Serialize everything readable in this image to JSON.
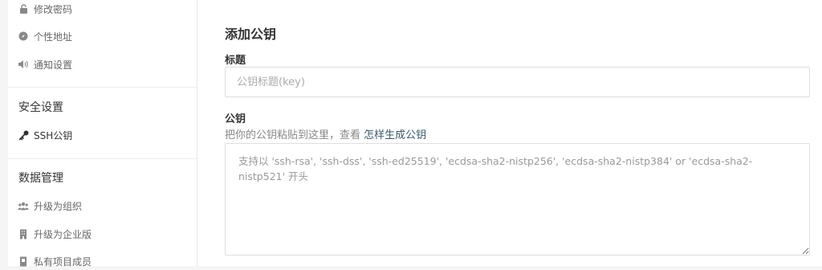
{
  "sidebar": {
    "items_top": [
      {
        "label": "修改密码",
        "icon": "lock-icon"
      },
      {
        "label": "个性地址",
        "icon": "compass-icon"
      },
      {
        "label": "通知设置",
        "icon": "volume-icon"
      }
    ],
    "security": {
      "title": "安全设置",
      "items": [
        {
          "label": "SSH公钥",
          "icon": "key-icon"
        }
      ]
    },
    "data_management": {
      "title": "数据管理",
      "items": [
        {
          "label": "升级为组织",
          "icon": "users-icon"
        },
        {
          "label": "升级为企业版",
          "icon": "building-icon"
        },
        {
          "label": "私有项目成员",
          "icon": "member-icon"
        }
      ]
    }
  },
  "form": {
    "heading": "添加公钥",
    "title_label": "标题",
    "title_placeholder": "公钥标题(key)",
    "key_label": "公钥",
    "help_text": "把你的公钥粘贴到这里，查看 ",
    "help_link": "怎样生成公钥",
    "key_placeholder": "支持以 'ssh-rsa', 'ssh-dss', 'ssh-ed25519', 'ecdsa-sha2-nistp256', 'ecdsa-sha2-nistp384' or 'ecdsa-sha2-nistp521' 开头"
  }
}
